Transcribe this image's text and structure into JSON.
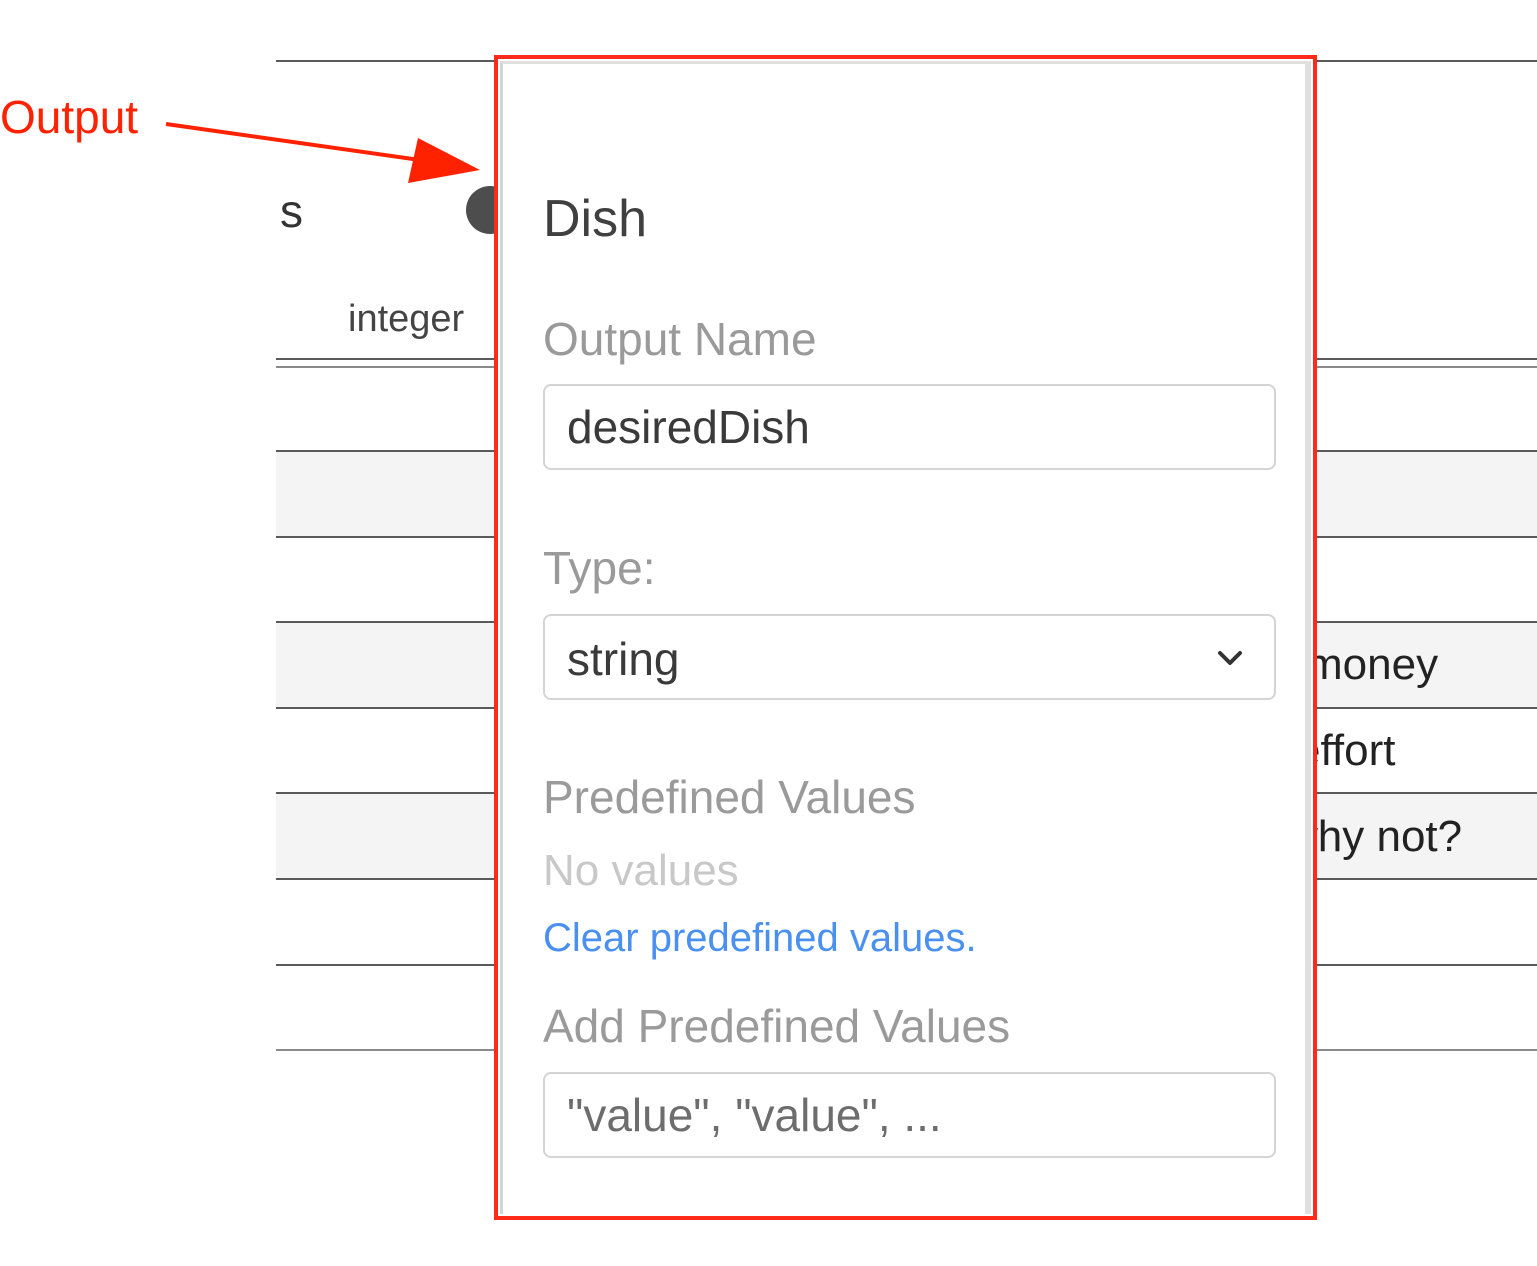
{
  "annotation": {
    "label": "Output",
    "color": "#ff2200"
  },
  "background_table": {
    "header_partial": "s",
    "column_type": "integer",
    "cells": [
      "money",
      "effort",
      "why not?"
    ]
  },
  "popover": {
    "title": "Dish",
    "output_name_label": "Output Name",
    "output_name_value": "desiredDish",
    "type_label": "Type:",
    "type_value": "string",
    "type_dropdown_icon": "chevron-down-icon",
    "predefined_values_label": "Predefined Values",
    "predefined_values_empty": "No values",
    "clear_link": "Clear predefined values.",
    "add_predefined_label": "Add Predefined Values",
    "add_predefined_placeholder": "\"value\", \"value\", ...",
    "border_color": "#ff2a1a",
    "link_color": "#4a90f0"
  }
}
